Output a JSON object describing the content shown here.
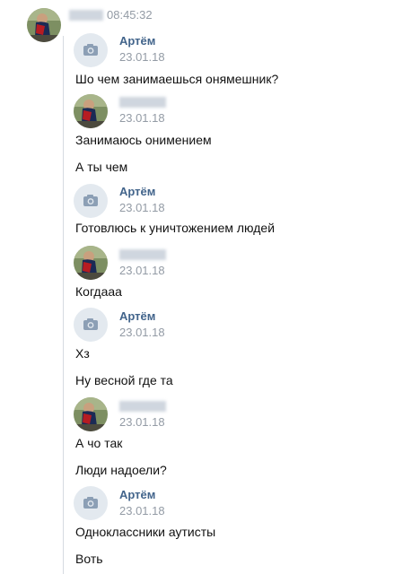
{
  "header": {
    "time": "08:45:32"
  },
  "messages": [
    {
      "author": "Артём",
      "date": "23.01.18",
      "lines": [
        "Шо чем занимаешься онямешник?"
      ]
    },
    {
      "author": "",
      "date": "23.01.18",
      "lines": [
        "Занимаюсь онимением",
        "А ты чем"
      ]
    },
    {
      "author": "Артём",
      "date": "23.01.18",
      "lines": [
        "Готовлюсь к уничтожением людей"
      ]
    },
    {
      "author": "",
      "date": "23.01.18",
      "lines": [
        "Когдааа"
      ]
    },
    {
      "author": "Артём",
      "date": "23.01.18",
      "lines": [
        "Хз",
        "Ну весной где та"
      ]
    },
    {
      "author": "",
      "date": "23.01.18",
      "lines": [
        "А чо так",
        "Люди надоели?"
      ]
    },
    {
      "author": "Артём",
      "date": "23.01.18",
      "lines": [
        "Одноклассники аутисты",
        "Воть"
      ]
    }
  ],
  "colors": {
    "author": "#42648b",
    "date": "#939ba5",
    "camera_bg": "#e3e9ef"
  },
  "icons": {
    "camera_avatar": "camera-icon",
    "user_avatar": "user-photo"
  }
}
